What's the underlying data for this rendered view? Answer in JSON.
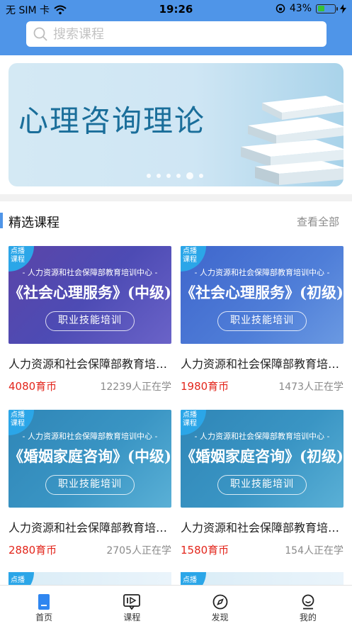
{
  "status_bar": {
    "carrier": "无 SIM 卡",
    "time": "19:26",
    "battery": "43%",
    "battery_level": 0.43
  },
  "search": {
    "placeholder": "搜索课程"
  },
  "banner": {
    "title": "心理咨询理论",
    "dots_count": 6,
    "active_dot": 4
  },
  "section": {
    "title": "精选课程",
    "more": "查看全部"
  },
  "courses": [
    {
      "tag": "点播课程",
      "org": "- 人力资源和社会保障部教育培训中心 -",
      "name": "《社会心理服务》(中级)",
      "pill": "职业技能培训",
      "title": "人力资源和社会保障部教育培训中心社会心理服务(中级)",
      "price": "4080育币",
      "learners": "12239人正在学"
    },
    {
      "tag": "点播课程",
      "org": "- 人力资源和社会保障部教育培训中心 -",
      "name": "《社会心理服务》(初级)",
      "pill": "职业技能培训",
      "title": "人力资源和社会保障部教育培训中心社会心理服务(初级)",
      "price": "1980育币",
      "learners": "1473人正在学"
    },
    {
      "tag": "点播课程",
      "org": "- 人力资源和社会保障部教育培训中心 -",
      "name": "《婚姻家庭咨询》(中级)",
      "pill": "职业技能培训",
      "title": "人力资源和社会保障部教育培训中心婚姻家庭咨询(中级)",
      "price": "2880育币",
      "learners": "2705人正在学"
    },
    {
      "tag": "点播课程",
      "org": "- 人力资源和社会保障部教育培训中心 -",
      "name": "《婚姻家庭咨询》(初级)",
      "pill": "职业技能培训",
      "title": "人力资源和社会保障部教育培训中心婚姻家庭咨询(初级)",
      "price": "1580育币",
      "learners": "154人正在学"
    }
  ],
  "peek": {
    "tag": "点播"
  },
  "tabbar": [
    {
      "label": "首页",
      "icon": "home-icon",
      "active": true
    },
    {
      "label": "课程",
      "icon": "course-play-icon"
    },
    {
      "label": "发现",
      "icon": "compass-icon"
    },
    {
      "label": "我的",
      "icon": "profile-icon"
    }
  ],
  "colors": {
    "accent": "#4f95e8",
    "price": "#e3261c",
    "corner_badge": "#2ba6e8"
  }
}
